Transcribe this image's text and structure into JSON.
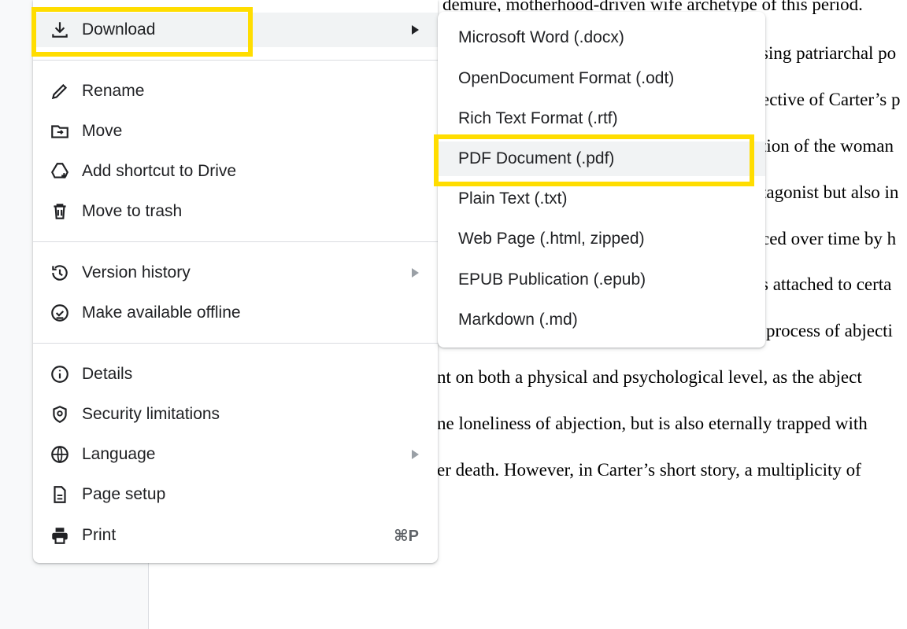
{
  "document": {
    "lines": [
      "demure, motherhood-driven wife archetype of this period.",
      "sing patriarchal po",
      "ective of Carter’s p",
      "tion of the woman",
      "tagonist but also in",
      "ced over time by h",
      "s attached to certa",
      "process of abjecti",
      "nt on both a physical and psychological level, as the abject",
      "ne loneliness of abjection, but is also eternally trapped with",
      "er death. However, in Carter’s short story, a multiplicity of"
    ]
  },
  "menu": {
    "download": "Download",
    "rename": "Rename",
    "move": "Move",
    "add_shortcut": "Add shortcut to Drive",
    "trash": "Move to trash",
    "version_history": "Version history",
    "offline": "Make available offline",
    "details": "Details",
    "security": "Security limitations",
    "language": "Language",
    "page_setup": "Page setup",
    "print": "Print",
    "print_shortcut": "⌘P"
  },
  "submenu": {
    "items": [
      "Microsoft Word (.docx)",
      "OpenDocument Format (.odt)",
      "Rich Text Format (.rtf)",
      "PDF Document (.pdf)",
      "Plain Text (.txt)",
      "Web Page (.html, zipped)",
      "EPUB Publication (.epub)",
      "Markdown (.md)"
    ]
  },
  "colors": {
    "highlight": "#ffdd00",
    "hover": "#f1f3f4",
    "text": "#202124",
    "divider": "#dadce0"
  }
}
